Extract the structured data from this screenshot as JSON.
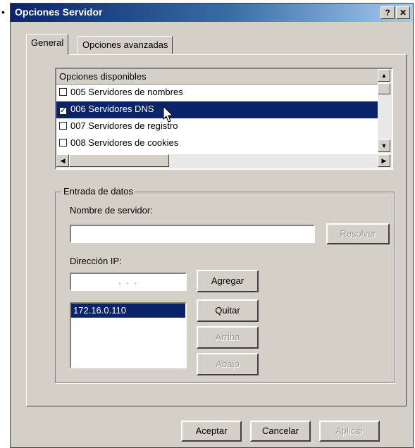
{
  "window": {
    "title": "Opciones Servidor",
    "help_label": "?",
    "close_label": "✕"
  },
  "tabs": [
    {
      "label": "General"
    },
    {
      "label": "Opciones avanzadas"
    }
  ],
  "options_list": {
    "header": "Opciones disponibles",
    "items": [
      {
        "label": "005 Servidores de nombres",
        "checked": false
      },
      {
        "label": "006 Servidores DNS",
        "checked": true
      },
      {
        "label": "007 Servidores de registro",
        "checked": false
      },
      {
        "label": "008 Servidores de cookies",
        "checked": false
      }
    ],
    "selected_index": 1
  },
  "entry": {
    "group_label": "Entrada de datos",
    "server_name_label": "Nombre de servidor:",
    "server_name_value": "",
    "resolve_label": "Resolver",
    "ip_label": "Dirección IP:",
    "ip_placeholder": ". . .",
    "ip_list": [
      "172.16.0.110"
    ],
    "add_label": "Agregar",
    "remove_label": "Quitar",
    "up_label": "Arriba",
    "down_label": "Abajo"
  },
  "footer": {
    "accept_label": "Aceptar",
    "cancel_label": "Cancelar",
    "apply_label": "Aplicar"
  },
  "colors": {
    "selection": "#0a246a",
    "face": "#d4d0c8"
  }
}
